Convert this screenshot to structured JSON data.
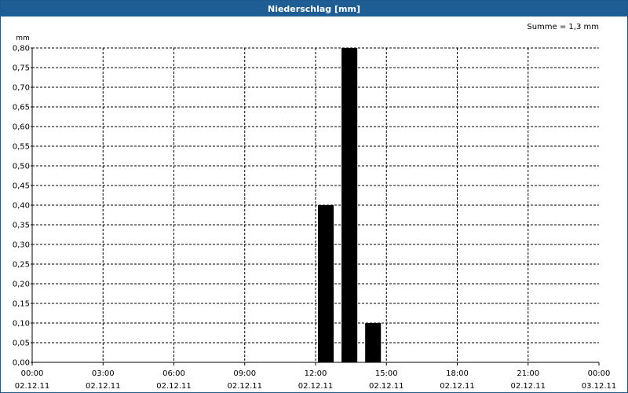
{
  "window": {
    "title": "Niederschlag [mm]"
  },
  "sum_label": "Summe = 1,3 mm",
  "colors": {
    "titlebar": "#1e5e94",
    "bar": "#000000",
    "grid": "#000000"
  },
  "chart_data": {
    "type": "bar",
    "title": "Niederschlag [mm]",
    "ylabel": "mm",
    "xlabel": "",
    "ylim": [
      0,
      0.8
    ],
    "yticks": [
      "0,00",
      "0,05",
      "0,10",
      "0,15",
      "0,20",
      "0,25",
      "0,30",
      "0,35",
      "0,40",
      "0,45",
      "0,50",
      "0,55",
      "0,60",
      "0,65",
      "0,70",
      "0,75",
      "0,80"
    ],
    "xlim_hours": [
      0,
      24
    ],
    "xticks": [
      {
        "time": "00:00",
        "date": "02.12.11"
      },
      {
        "time": "03:00",
        "date": "02.12.11"
      },
      {
        "time": "06:00",
        "date": "02.12.11"
      },
      {
        "time": "09:00",
        "date": "02.12.11"
      },
      {
        "time": "12:00",
        "date": "02.12.11"
      },
      {
        "time": "15:00",
        "date": "02.12.11"
      },
      {
        "time": "18:00",
        "date": "02.12.11"
      },
      {
        "time": "21:00",
        "date": "02.12.11"
      },
      {
        "time": "00:00",
        "date": "03.12.11"
      }
    ],
    "grid": true,
    "bars": [
      {
        "start_hour": 12,
        "value": 0.4
      },
      {
        "start_hour": 13,
        "value": 0.8
      },
      {
        "start_hour": 14,
        "value": 0.1
      }
    ]
  }
}
